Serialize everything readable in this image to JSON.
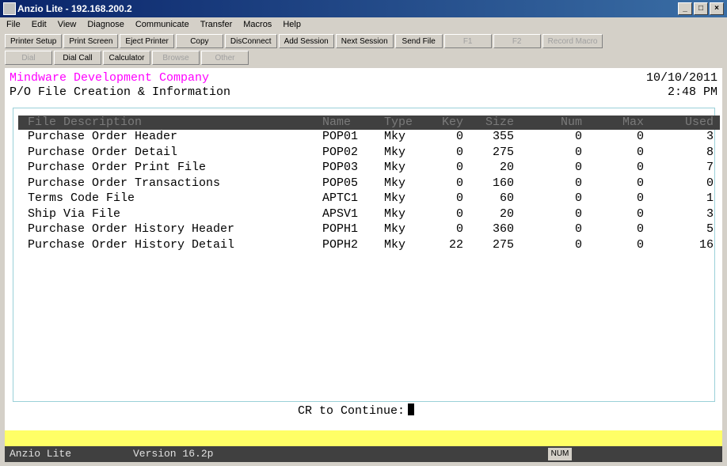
{
  "window": {
    "title": "Anzio Lite - 192.168.200.2"
  },
  "menu": [
    "File",
    "Edit",
    "View",
    "Diagnose",
    "Communicate",
    "Transfer",
    "Macros",
    "Help"
  ],
  "toolbar_row1": [
    {
      "label": "Printer Setup",
      "disabled": false
    },
    {
      "label": "Print Screen",
      "disabled": false
    },
    {
      "label": "Eject Printer",
      "disabled": false
    },
    {
      "label": "Copy",
      "disabled": false
    },
    {
      "label": "DisConnect",
      "disabled": false
    },
    {
      "label": "Add Session",
      "disabled": false
    },
    {
      "label": "Next Session",
      "disabled": false
    },
    {
      "label": "Send File",
      "disabled": false
    },
    {
      "label": "F1",
      "disabled": true
    },
    {
      "label": "F2",
      "disabled": true
    },
    {
      "label": "Record Macro",
      "disabled": true
    }
  ],
  "toolbar_row2": [
    {
      "label": "Dial",
      "disabled": true
    },
    {
      "label": "Dial Call",
      "disabled": false
    },
    {
      "label": "Calculator",
      "disabled": false
    },
    {
      "label": "Browse",
      "disabled": true
    },
    {
      "label": "Other",
      "disabled": true
    }
  ],
  "terminal": {
    "company": "Mindware Development Company",
    "date": "10/10/2011",
    "screen_title": "P/O File Creation & Information",
    "time": "2:48 PM",
    "headers": {
      "desc": "File Description",
      "name": "Name",
      "type": "Type",
      "key": "Key",
      "size": "Size",
      "num": "Num",
      "max": "Max",
      "used": "Used"
    },
    "rows": [
      {
        "desc": "Purchase Order Header",
        "name": "POP01",
        "type": "Mky",
        "key": "0",
        "size": "355",
        "num": "0",
        "max": "0",
        "used": "3"
      },
      {
        "desc": "Purchase Order Detail",
        "name": "POP02",
        "type": "Mky",
        "key": "0",
        "size": "275",
        "num": "0",
        "max": "0",
        "used": "8"
      },
      {
        "desc": "Purchase Order Print File",
        "name": "POP03",
        "type": "Mky",
        "key": "0",
        "size": "20",
        "num": "0",
        "max": "0",
        "used": "7"
      },
      {
        "desc": "Purchase Order Transactions",
        "name": "POP05",
        "type": "Mky",
        "key": "0",
        "size": "160",
        "num": "0",
        "max": "0",
        "used": "0"
      },
      {
        "desc": "Terms Code File",
        "name": "APTC1",
        "type": "Mky",
        "key": "0",
        "size": "60",
        "num": "0",
        "max": "0",
        "used": "1"
      },
      {
        "desc": "Ship Via File",
        "name": "APSV1",
        "type": "Mky",
        "key": "0",
        "size": "20",
        "num": "0",
        "max": "0",
        "used": "3"
      },
      {
        "desc": "Purchase Order History Header",
        "name": "POPH1",
        "type": "Mky",
        "key": "0",
        "size": "360",
        "num": "0",
        "max": "0",
        "used": "5"
      },
      {
        "desc": "Purchase Order History Detail",
        "name": "POPH2",
        "type": "Mky",
        "key": "22",
        "size": "275",
        "num": "0",
        "max": "0",
        "used": "16"
      }
    ],
    "prompt": "CR to Continue:"
  },
  "status": {
    "app": "Anzio Lite",
    "version": "Version 16.2p",
    "num": "NUM"
  }
}
